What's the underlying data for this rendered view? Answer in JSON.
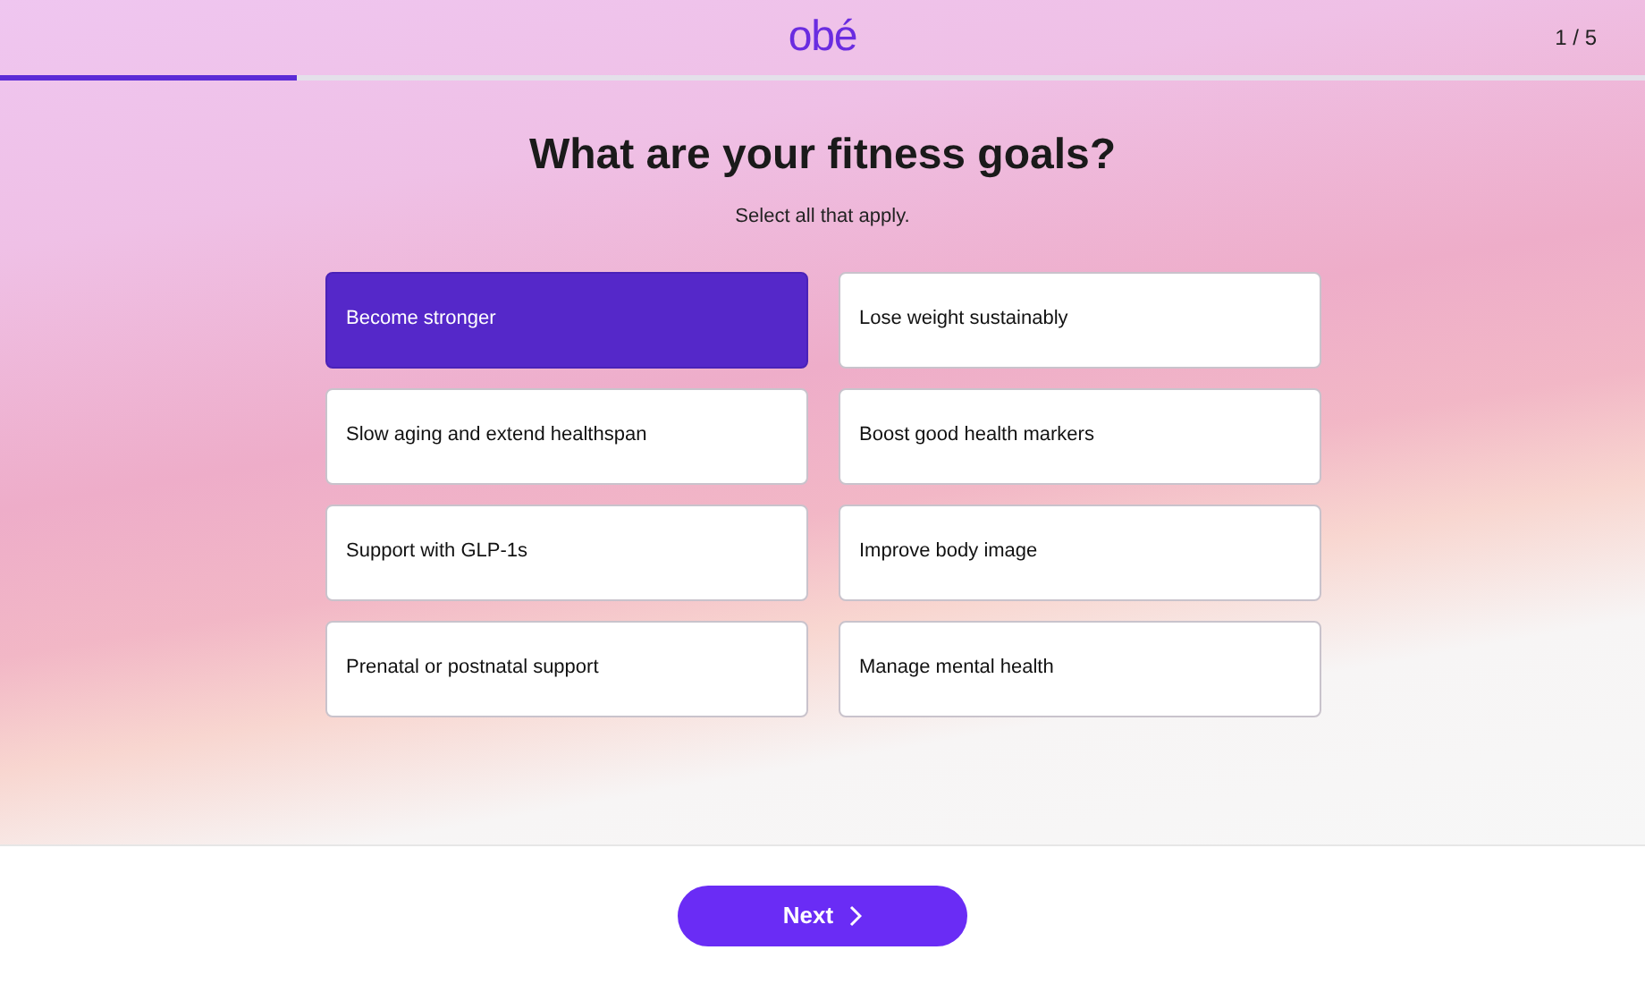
{
  "header": {
    "logo": "obé",
    "step": "1 / 5"
  },
  "progress": {
    "level": 0.18
  },
  "title": "What are your fitness goals?",
  "subtitle": "Select all that apply.",
  "options": [
    {
      "label": "Become stronger",
      "selected": true
    },
    {
      "label": "Lose weight sustainably",
      "selected": false
    },
    {
      "label": "Slow aging and extend healthspan",
      "selected": false
    },
    {
      "label": "Boost good health markers",
      "selected": false
    },
    {
      "label": "Support with GLP-1s",
      "selected": false
    },
    {
      "label": "Improve body image",
      "selected": false
    },
    {
      "label": "Prenatal or postnatal support",
      "selected": false
    },
    {
      "label": "Manage mental health",
      "selected": false
    }
  ],
  "next_button": {
    "label": "Next"
  }
}
